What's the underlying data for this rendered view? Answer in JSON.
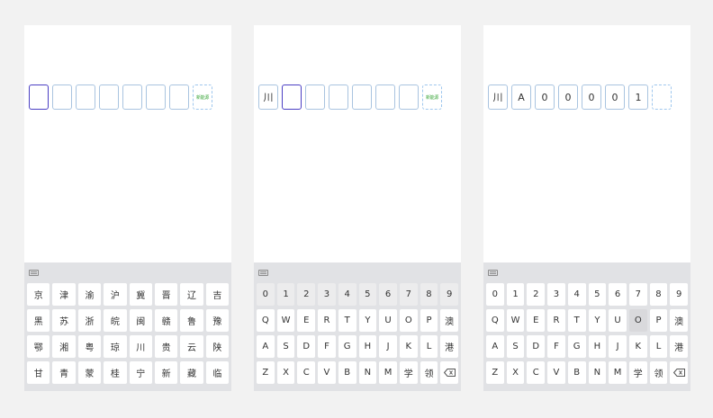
{
  "panels": [
    {
      "plate": [
        "",
        "",
        "",
        "",
        "",
        "",
        "",
        "新能源"
      ],
      "active": 0,
      "keyboard": {
        "type": "province",
        "rows": [
          [
            "京",
            "津",
            "渝",
            "沪",
            "冀",
            "晋",
            "辽",
            "吉"
          ],
          [
            "黑",
            "苏",
            "浙",
            "皖",
            "闽",
            "赣",
            "鲁",
            "豫"
          ],
          [
            "鄂",
            "湘",
            "粤",
            "琼",
            "川",
            "贵",
            "云",
            "陕"
          ],
          [
            "甘",
            "青",
            "蒙",
            "桂",
            "宁",
            "新",
            "藏",
            "临"
          ]
        ]
      }
    },
    {
      "plate": [
        "川",
        "",
        "",
        "",
        "",
        "",
        "",
        "新能源"
      ],
      "active": 1,
      "keyboard": {
        "type": "alnum",
        "rows": [
          [
            "0",
            "1",
            "2",
            "3",
            "4",
            "5",
            "6",
            "7",
            "8",
            "9"
          ],
          [
            "Q",
            "W",
            "E",
            "R",
            "T",
            "Y",
            "U",
            "O",
            "P",
            "澳"
          ],
          [
            "A",
            "S",
            "D",
            "F",
            "G",
            "H",
            "J",
            "K",
            "L",
            "港"
          ],
          [
            "Z",
            "X",
            "C",
            "V",
            "B",
            "N",
            "M",
            "学",
            "领",
            "⌫"
          ]
        ],
        "disabled": [
          "0",
          "1",
          "2",
          "3",
          "4",
          "5",
          "6",
          "7",
          "8",
          "9"
        ]
      }
    },
    {
      "plate": [
        "川",
        "A",
        "0",
        "0",
        "0",
        "0",
        "1",
        ""
      ],
      "active": 7,
      "keyboard": {
        "type": "alnum",
        "rows": [
          [
            "0",
            "1",
            "2",
            "3",
            "4",
            "5",
            "6",
            "7",
            "8",
            "9"
          ],
          [
            "Q",
            "W",
            "E",
            "R",
            "T",
            "Y",
            "U",
            "O",
            "P",
            "澳"
          ],
          [
            "A",
            "S",
            "D",
            "F",
            "G",
            "H",
            "J",
            "K",
            "L",
            "港"
          ],
          [
            "Z",
            "X",
            "C",
            "V",
            "B",
            "N",
            "M",
            "学",
            "领",
            "⌫"
          ]
        ],
        "pressed": [
          "O"
        ]
      }
    }
  ]
}
